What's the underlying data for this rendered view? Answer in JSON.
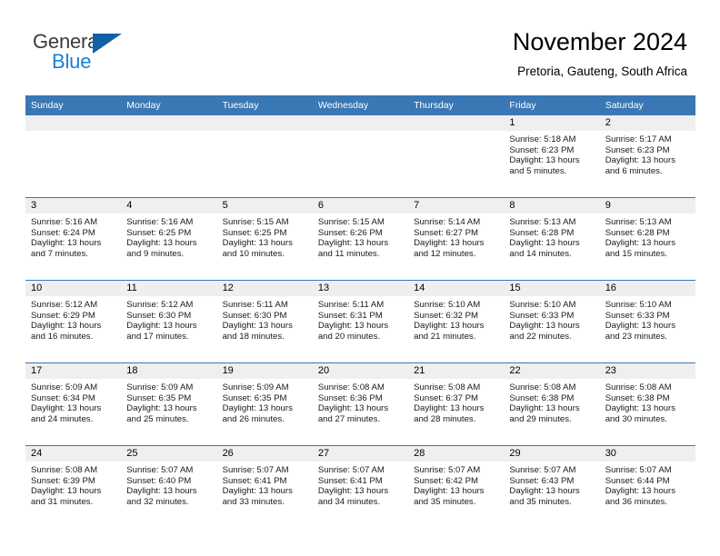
{
  "brand": {
    "name_part1": "General",
    "name_part2": "Blue"
  },
  "header": {
    "title": "November 2024",
    "subtitle": "Pretoria, Gauteng, South Africa"
  },
  "colors": {
    "header_blue": "#3a77b5",
    "logo_blue": "#1b7fd4",
    "logo_triangle": "#1061a8",
    "daynum_band": "#efefef"
  },
  "weekday_headers": [
    "Sunday",
    "Monday",
    "Tuesday",
    "Wednesday",
    "Thursday",
    "Friday",
    "Saturday"
  ],
  "weeks": [
    [
      {
        "day": "",
        "empty": true
      },
      {
        "day": "",
        "empty": true
      },
      {
        "day": "",
        "empty": true
      },
      {
        "day": "",
        "empty": true
      },
      {
        "day": "",
        "empty": true
      },
      {
        "day": "1",
        "sunrise": "Sunrise: 5:18 AM",
        "sunset": "Sunset: 6:23 PM",
        "daylight1": "Daylight: 13 hours",
        "daylight2": "and 5 minutes."
      },
      {
        "day": "2",
        "sunrise": "Sunrise: 5:17 AM",
        "sunset": "Sunset: 6:23 PM",
        "daylight1": "Daylight: 13 hours",
        "daylight2": "and 6 minutes."
      }
    ],
    [
      {
        "day": "3",
        "sunrise": "Sunrise: 5:16 AM",
        "sunset": "Sunset: 6:24 PM",
        "daylight1": "Daylight: 13 hours",
        "daylight2": "and 7 minutes."
      },
      {
        "day": "4",
        "sunrise": "Sunrise: 5:16 AM",
        "sunset": "Sunset: 6:25 PM",
        "daylight1": "Daylight: 13 hours",
        "daylight2": "and 9 minutes."
      },
      {
        "day": "5",
        "sunrise": "Sunrise: 5:15 AM",
        "sunset": "Sunset: 6:25 PM",
        "daylight1": "Daylight: 13 hours",
        "daylight2": "and 10 minutes."
      },
      {
        "day": "6",
        "sunrise": "Sunrise: 5:15 AM",
        "sunset": "Sunset: 6:26 PM",
        "daylight1": "Daylight: 13 hours",
        "daylight2": "and 11 minutes."
      },
      {
        "day": "7",
        "sunrise": "Sunrise: 5:14 AM",
        "sunset": "Sunset: 6:27 PM",
        "daylight1": "Daylight: 13 hours",
        "daylight2": "and 12 minutes."
      },
      {
        "day": "8",
        "sunrise": "Sunrise: 5:13 AM",
        "sunset": "Sunset: 6:28 PM",
        "daylight1": "Daylight: 13 hours",
        "daylight2": "and 14 minutes."
      },
      {
        "day": "9",
        "sunrise": "Sunrise: 5:13 AM",
        "sunset": "Sunset: 6:28 PM",
        "daylight1": "Daylight: 13 hours",
        "daylight2": "and 15 minutes."
      }
    ],
    [
      {
        "day": "10",
        "sunrise": "Sunrise: 5:12 AM",
        "sunset": "Sunset: 6:29 PM",
        "daylight1": "Daylight: 13 hours",
        "daylight2": "and 16 minutes."
      },
      {
        "day": "11",
        "sunrise": "Sunrise: 5:12 AM",
        "sunset": "Sunset: 6:30 PM",
        "daylight1": "Daylight: 13 hours",
        "daylight2": "and 17 minutes."
      },
      {
        "day": "12",
        "sunrise": "Sunrise: 5:11 AM",
        "sunset": "Sunset: 6:30 PM",
        "daylight1": "Daylight: 13 hours",
        "daylight2": "and 18 minutes."
      },
      {
        "day": "13",
        "sunrise": "Sunrise: 5:11 AM",
        "sunset": "Sunset: 6:31 PM",
        "daylight1": "Daylight: 13 hours",
        "daylight2": "and 20 minutes."
      },
      {
        "day": "14",
        "sunrise": "Sunrise: 5:10 AM",
        "sunset": "Sunset: 6:32 PM",
        "daylight1": "Daylight: 13 hours",
        "daylight2": "and 21 minutes."
      },
      {
        "day": "15",
        "sunrise": "Sunrise: 5:10 AM",
        "sunset": "Sunset: 6:33 PM",
        "daylight1": "Daylight: 13 hours",
        "daylight2": "and 22 minutes."
      },
      {
        "day": "16",
        "sunrise": "Sunrise: 5:10 AM",
        "sunset": "Sunset: 6:33 PM",
        "daylight1": "Daylight: 13 hours",
        "daylight2": "and 23 minutes."
      }
    ],
    [
      {
        "day": "17",
        "sunrise": "Sunrise: 5:09 AM",
        "sunset": "Sunset: 6:34 PM",
        "daylight1": "Daylight: 13 hours",
        "daylight2": "and 24 minutes."
      },
      {
        "day": "18",
        "sunrise": "Sunrise: 5:09 AM",
        "sunset": "Sunset: 6:35 PM",
        "daylight1": "Daylight: 13 hours",
        "daylight2": "and 25 minutes."
      },
      {
        "day": "19",
        "sunrise": "Sunrise: 5:09 AM",
        "sunset": "Sunset: 6:35 PM",
        "daylight1": "Daylight: 13 hours",
        "daylight2": "and 26 minutes."
      },
      {
        "day": "20",
        "sunrise": "Sunrise: 5:08 AM",
        "sunset": "Sunset: 6:36 PM",
        "daylight1": "Daylight: 13 hours",
        "daylight2": "and 27 minutes."
      },
      {
        "day": "21",
        "sunrise": "Sunrise: 5:08 AM",
        "sunset": "Sunset: 6:37 PM",
        "daylight1": "Daylight: 13 hours",
        "daylight2": "and 28 minutes."
      },
      {
        "day": "22",
        "sunrise": "Sunrise: 5:08 AM",
        "sunset": "Sunset: 6:38 PM",
        "daylight1": "Daylight: 13 hours",
        "daylight2": "and 29 minutes."
      },
      {
        "day": "23",
        "sunrise": "Sunrise: 5:08 AM",
        "sunset": "Sunset: 6:38 PM",
        "daylight1": "Daylight: 13 hours",
        "daylight2": "and 30 minutes."
      }
    ],
    [
      {
        "day": "24",
        "sunrise": "Sunrise: 5:08 AM",
        "sunset": "Sunset: 6:39 PM",
        "daylight1": "Daylight: 13 hours",
        "daylight2": "and 31 minutes."
      },
      {
        "day": "25",
        "sunrise": "Sunrise: 5:07 AM",
        "sunset": "Sunset: 6:40 PM",
        "daylight1": "Daylight: 13 hours",
        "daylight2": "and 32 minutes."
      },
      {
        "day": "26",
        "sunrise": "Sunrise: 5:07 AM",
        "sunset": "Sunset: 6:41 PM",
        "daylight1": "Daylight: 13 hours",
        "daylight2": "and 33 minutes."
      },
      {
        "day": "27",
        "sunrise": "Sunrise: 5:07 AM",
        "sunset": "Sunset: 6:41 PM",
        "daylight1": "Daylight: 13 hours",
        "daylight2": "and 34 minutes."
      },
      {
        "day": "28",
        "sunrise": "Sunrise: 5:07 AM",
        "sunset": "Sunset: 6:42 PM",
        "daylight1": "Daylight: 13 hours",
        "daylight2": "and 35 minutes."
      },
      {
        "day": "29",
        "sunrise": "Sunrise: 5:07 AM",
        "sunset": "Sunset: 6:43 PM",
        "daylight1": "Daylight: 13 hours",
        "daylight2": "and 35 minutes."
      },
      {
        "day": "30",
        "sunrise": "Sunrise: 5:07 AM",
        "sunset": "Sunset: 6:44 PM",
        "daylight1": "Daylight: 13 hours",
        "daylight2": "and 36 minutes."
      }
    ]
  ]
}
